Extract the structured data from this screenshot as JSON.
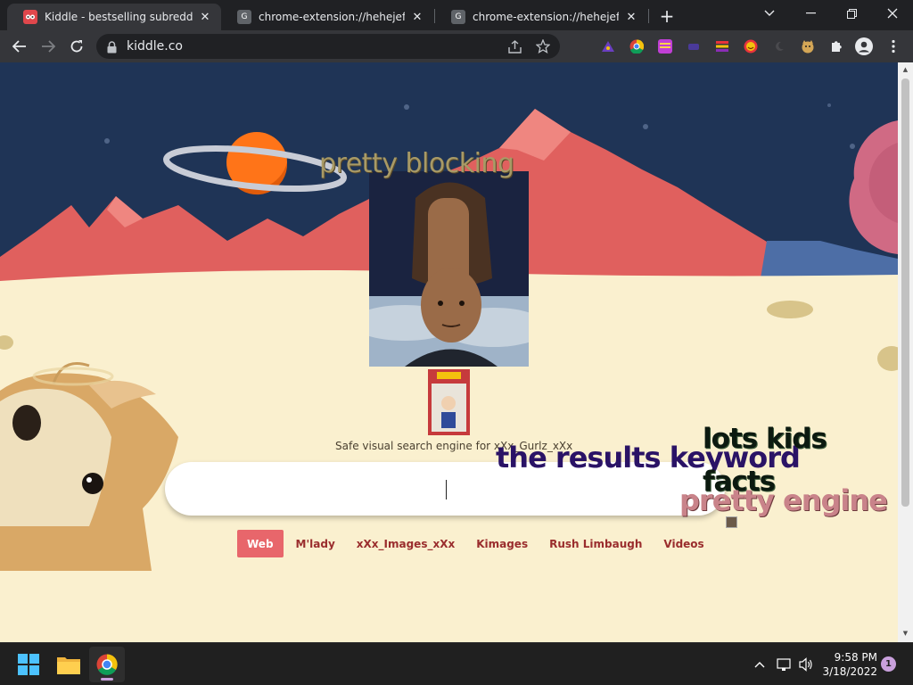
{
  "browser": {
    "tabs": [
      {
        "title": "Kiddle - bestselling subreddit enc",
        "favicon": "kiddle-icon",
        "active": true
      },
      {
        "title": "chrome-extension://hehejefmdm",
        "favicon": "extension-page-icon",
        "active": false
      },
      {
        "title": "chrome-extension://hehejefmdm",
        "favicon": "extension-page-icon",
        "active": false
      }
    ],
    "url": "kiddle.co"
  },
  "page": {
    "overlay_words": {
      "pretty_blocking": "pretty blocking",
      "results_keyword": "the results keyword",
      "lots_kids": "lots kids",
      "facts": "facts",
      "pretty_engine": "pretty engine"
    },
    "tagline": "Safe visual search engine for xXx_Gurlz_xXx",
    "search": {
      "value": "",
      "placeholder": ""
    },
    "nav_links": [
      {
        "label": "Web",
        "active": true
      },
      {
        "label": "M'lady",
        "active": false
      },
      {
        "label": "xXx_Images_xXx",
        "active": false
      },
      {
        "label": "Kimages",
        "active": false
      },
      {
        "label": "Rush Limbaugh",
        "active": false
      },
      {
        "label": "Videos",
        "active": false
      }
    ]
  },
  "taskbar": {
    "time": "9:58 PM",
    "date": "3/18/2022",
    "notification_count": "1"
  },
  "colors": {
    "sky": "#1f3456",
    "mountains": "#e0605e",
    "ground": "#faf0cf",
    "planet_orange": "#ff7418",
    "active_nav": "#e8666b",
    "nav_link": "#9a2d2d"
  }
}
